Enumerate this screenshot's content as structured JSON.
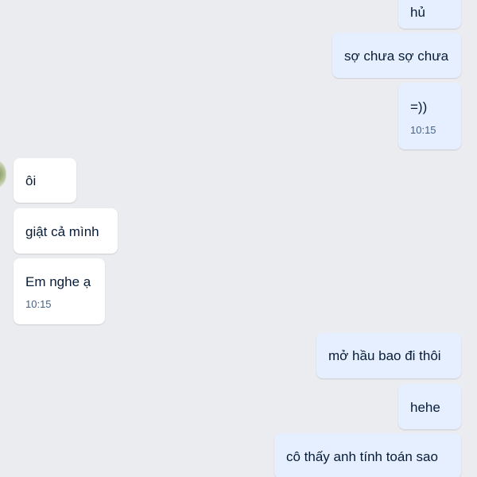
{
  "messages_out_top": [
    {
      "text": "hủ"
    },
    {
      "text": "sợ chưa sợ chưa"
    },
    {
      "text": "=))",
      "time": "10:15"
    }
  ],
  "messages_in": [
    {
      "text": "ôi"
    },
    {
      "text": "giật cả mình"
    },
    {
      "text": "Em nghe ạ",
      "time": "10:15"
    }
  ],
  "messages_out_bottom": [
    {
      "text": "mở hầu bao đi thôi"
    },
    {
      "text": "hehe"
    },
    {
      "text": "cô thấy anh tính toán sao"
    }
  ],
  "colors": {
    "background": "#ebecf0",
    "outgoing_bubble": "#e5efff",
    "incoming_bubble": "#ffffff",
    "text": "#081c36",
    "time": "#476285"
  }
}
